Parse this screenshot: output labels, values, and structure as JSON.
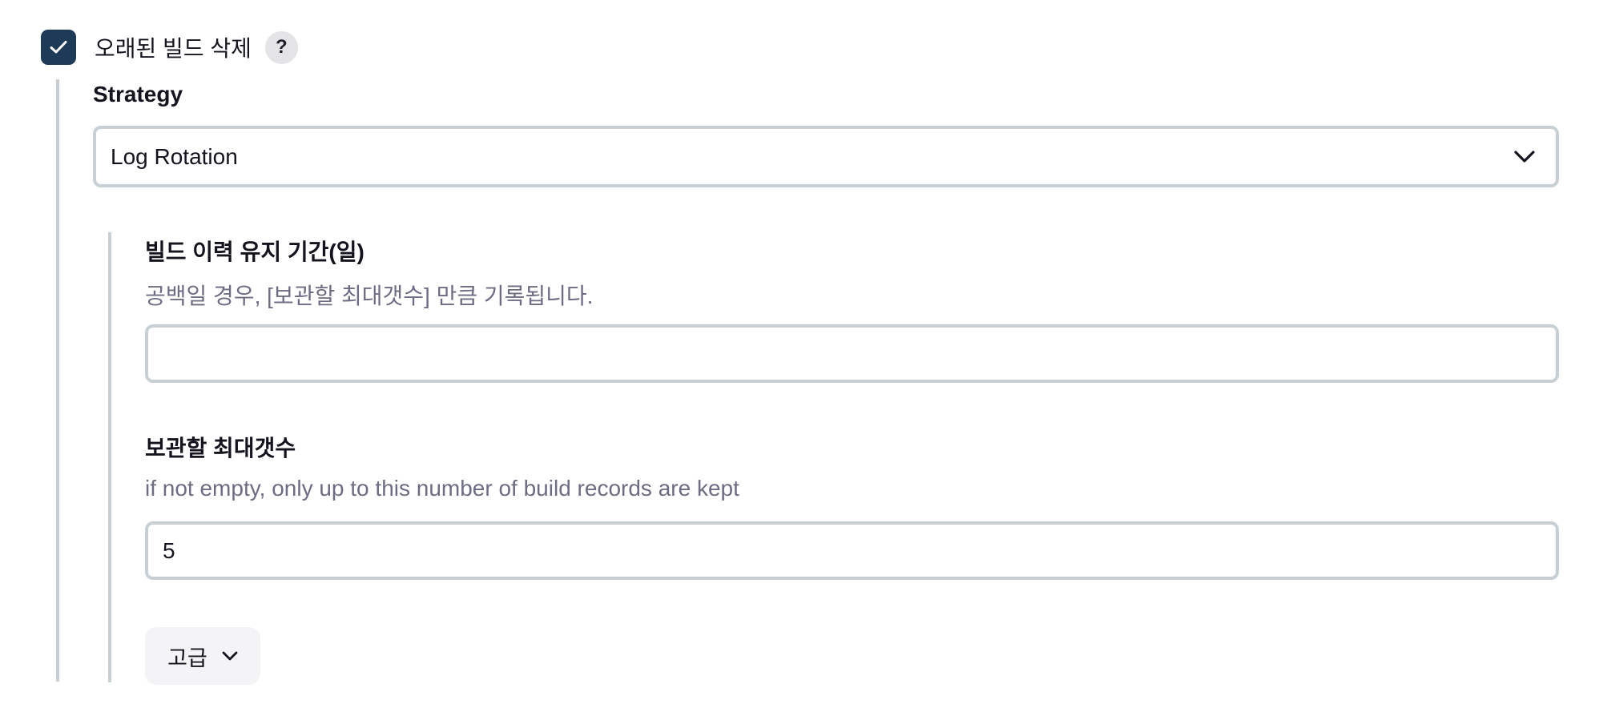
{
  "discard_old_builds": {
    "checked": true,
    "label": "오래된 빌드 삭제",
    "help": "?"
  },
  "strategy": {
    "label": "Strategy",
    "selected": "Log Rotation"
  },
  "days_to_keep": {
    "label": "빌드 이력 유지 기간(일)",
    "description": "공백일 경우, [보관할 최대갯수] 만큼 기록됩니다.",
    "value": ""
  },
  "max_to_keep": {
    "label": "보관할 최대갯수",
    "description": "if not empty, only up to this number of build records are kept",
    "value": "5"
  },
  "advanced": {
    "label": "고급"
  },
  "colors": {
    "checkbox_bg": "#1d3a57",
    "border": "#c9d0d4",
    "description_text": "#6c6c83",
    "button_bg": "#f4f4f6"
  },
  "icons": {
    "checkbox": "check-icon",
    "select": "chevron-down-icon",
    "advanced": "chevron-down-icon"
  }
}
